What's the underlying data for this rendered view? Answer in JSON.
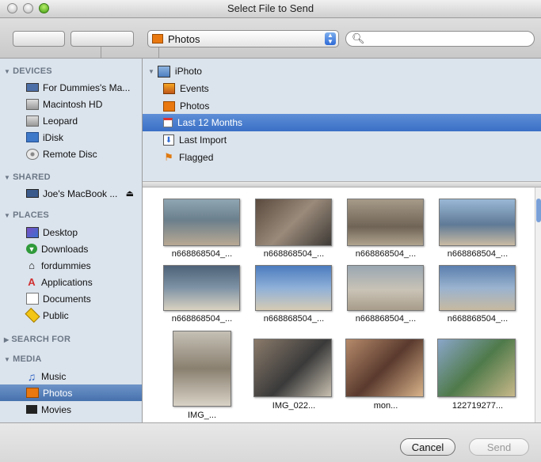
{
  "window": {
    "title": "Select File to Send"
  },
  "toolbar": {
    "nav_back_icon": "left-triangle",
    "nav_forward_icon": "right-triangle",
    "views": [
      "icon-view",
      "list-view",
      "column-view"
    ],
    "location_popup": "Photos",
    "search_placeholder": ""
  },
  "sidebar": {
    "devices_header": "DEVICES",
    "devices": [
      {
        "label": "For Dummies's Ma...",
        "icon": "laptop-icon"
      },
      {
        "label": "Macintosh HD",
        "icon": "harddisk-icon"
      },
      {
        "label": "Leopard",
        "icon": "harddisk-icon"
      },
      {
        "label": "iDisk",
        "icon": "idisk-icon"
      },
      {
        "label": "Remote Disc",
        "icon": "disc-icon"
      }
    ],
    "shared_header": "SHARED",
    "shared": [
      {
        "label": "Joe's MacBook ...",
        "icon": "laptop-icon",
        "eject": "⏏"
      }
    ],
    "places_header": "PLACES",
    "places": [
      {
        "label": "Desktop",
        "icon": "desktop-icon"
      },
      {
        "label": "Downloads",
        "icon": "downloads-icon"
      },
      {
        "label": "fordummies",
        "icon": "home-icon"
      },
      {
        "label": "Applications",
        "icon": "applications-icon"
      },
      {
        "label": "Documents",
        "icon": "documents-icon"
      },
      {
        "label": "Public",
        "icon": "public-icon"
      }
    ],
    "search_header": "SEARCH FOR",
    "media_header": "MEDIA",
    "media": [
      {
        "label": "Music",
        "icon": "music-icon"
      },
      {
        "label": "Photos",
        "icon": "photos-icon",
        "selected": true
      },
      {
        "label": "Movies",
        "icon": "movies-icon"
      }
    ]
  },
  "library": {
    "root": "iPhoto",
    "items": [
      {
        "label": "Events",
        "icon": "events-icon"
      },
      {
        "label": "Photos",
        "icon": "photos-icon"
      },
      {
        "label": "Last 12 Months",
        "icon": "calendar-icon",
        "selected": true
      },
      {
        "label": "Last Import",
        "icon": "import-icon"
      },
      {
        "label": "Flagged",
        "icon": "flag-icon"
      }
    ]
  },
  "photos": [
    {
      "caption": "n668868504_...",
      "bg": "#6b7f8c"
    },
    {
      "caption": "n668868504_...",
      "bg": "#7a6a5a"
    },
    {
      "caption": "n668868504_...",
      "bg": "#8a7d6a"
    },
    {
      "caption": "n668868504_...",
      "bg": "#5f7a96"
    },
    {
      "caption": "n668868504_...",
      "bg": "#59708a"
    },
    {
      "caption": "n668868504_...",
      "bg": "#6f8fb1"
    },
    {
      "caption": "n668868504_...",
      "bg": "#9a9388"
    },
    {
      "caption": "n668868504_...",
      "bg": "#6f8aa8"
    },
    {
      "caption": "IMG_...",
      "bg": "#8a8070"
    },
    {
      "caption": "IMG_022...",
      "bg": "#4a4a4a"
    },
    {
      "caption": "mon...",
      "bg": "#8a6a5a"
    },
    {
      "caption": "122719277...",
      "bg": "#6a8a6a"
    }
  ],
  "footer": {
    "cancel": "Cancel",
    "send": "Send"
  }
}
